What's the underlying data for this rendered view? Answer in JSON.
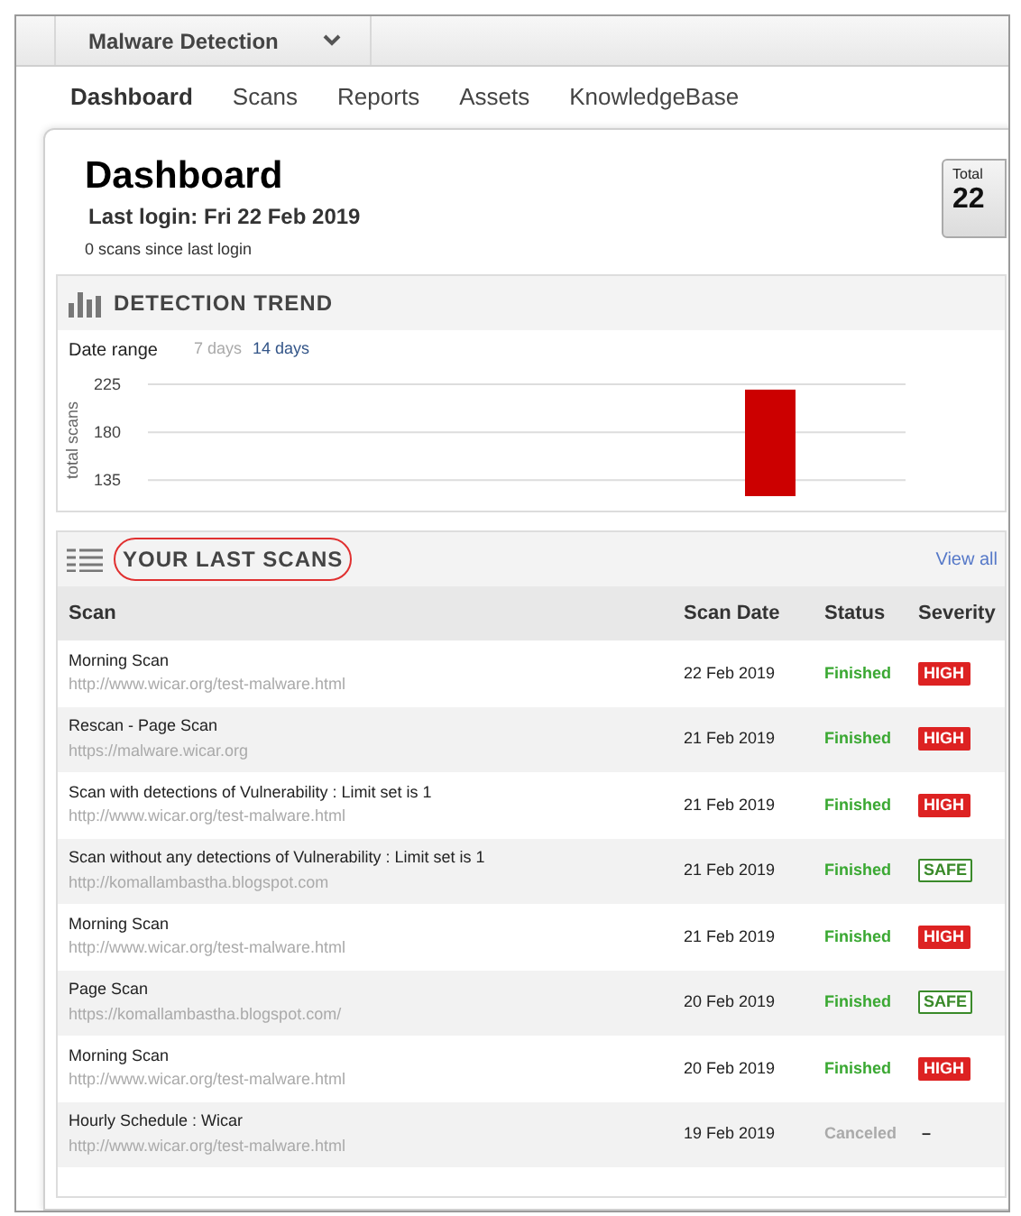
{
  "app_menu": {
    "label": "Malware Detection"
  },
  "tabs": [
    {
      "label": "Dashboard",
      "selected": true
    },
    {
      "label": "Scans",
      "selected": false
    },
    {
      "label": "Reports",
      "selected": false
    },
    {
      "label": "Assets",
      "selected": false
    },
    {
      "label": "KnowledgeBase",
      "selected": false
    }
  ],
  "header": {
    "title": "Dashboard",
    "last_login": "Last login: Fri 22 Feb 2019",
    "subtitle": "0 scans since last login",
    "total_label": "Total",
    "total_value": "22"
  },
  "detection_trend": {
    "title": "DETECTION TREND",
    "date_range_label": "Date range",
    "ranges": [
      {
        "label": "7 days",
        "selected": false
      },
      {
        "label": "14 days",
        "selected": true
      }
    ],
    "chart_data": {
      "type": "bar",
      "ylabel": "total scans",
      "yticks": [
        135,
        180,
        225
      ],
      "ylim": [
        120,
        225
      ],
      "series": [
        {
          "color": "#cc0000",
          "values": [
            null,
            null,
            null,
            null,
            null,
            null,
            null,
            null,
            null,
            null,
            null,
            220,
            null,
            null
          ]
        }
      ]
    }
  },
  "last_scans": {
    "title": "YOUR LAST SCANS",
    "view_all": "View all",
    "columns": [
      "Scan",
      "Scan Date",
      "Status",
      "Severity"
    ],
    "rows": [
      {
        "name": "Morning Scan",
        "url": "http://www.wicar.org/test-malware.html",
        "date": "22 Feb 2019",
        "status": {
          "label": "Finished",
          "kind": "finished"
        },
        "severity": {
          "label": "HIGH",
          "kind": "high"
        }
      },
      {
        "name": "Rescan - Page Scan",
        "url": "https://malware.wicar.org",
        "date": "21 Feb 2019",
        "status": {
          "label": "Finished",
          "kind": "finished"
        },
        "severity": {
          "label": "HIGH",
          "kind": "high"
        }
      },
      {
        "name": "Scan with detections of Vulnerability : Limit set is 1",
        "url": "http://www.wicar.org/test-malware.html",
        "date": "21 Feb 2019",
        "status": {
          "label": "Finished",
          "kind": "finished"
        },
        "severity": {
          "label": "HIGH",
          "kind": "high"
        }
      },
      {
        "name": "Scan without any detections of Vulnerability : Limit set is 1",
        "url": "http://komallambastha.blogspot.com",
        "date": "21 Feb 2019",
        "status": {
          "label": "Finished",
          "kind": "finished"
        },
        "severity": {
          "label": "SAFE",
          "kind": "safe"
        }
      },
      {
        "name": "Morning Scan",
        "url": "http://www.wicar.org/test-malware.html",
        "date": "21 Feb 2019",
        "status": {
          "label": "Finished",
          "kind": "finished"
        },
        "severity": {
          "label": "HIGH",
          "kind": "high"
        }
      },
      {
        "name": "Page Scan",
        "url": "https://komallambastha.blogspot.com/",
        "date": "20 Feb 2019",
        "status": {
          "label": "Finished",
          "kind": "finished"
        },
        "severity": {
          "label": "SAFE",
          "kind": "safe"
        }
      },
      {
        "name": "Morning Scan",
        "url": "http://www.wicar.org/test-malware.html",
        "date": "20 Feb 2019",
        "status": {
          "label": "Finished",
          "kind": "finished"
        },
        "severity": {
          "label": "HIGH",
          "kind": "high"
        }
      },
      {
        "name": "Hourly Schedule : Wicar",
        "url": "http://www.wicar.org/test-malware.html",
        "date": "19 Feb 2019",
        "status": {
          "label": "Canceled",
          "kind": "canceled"
        },
        "severity": {
          "label": "–",
          "kind": "none"
        }
      }
    ]
  }
}
